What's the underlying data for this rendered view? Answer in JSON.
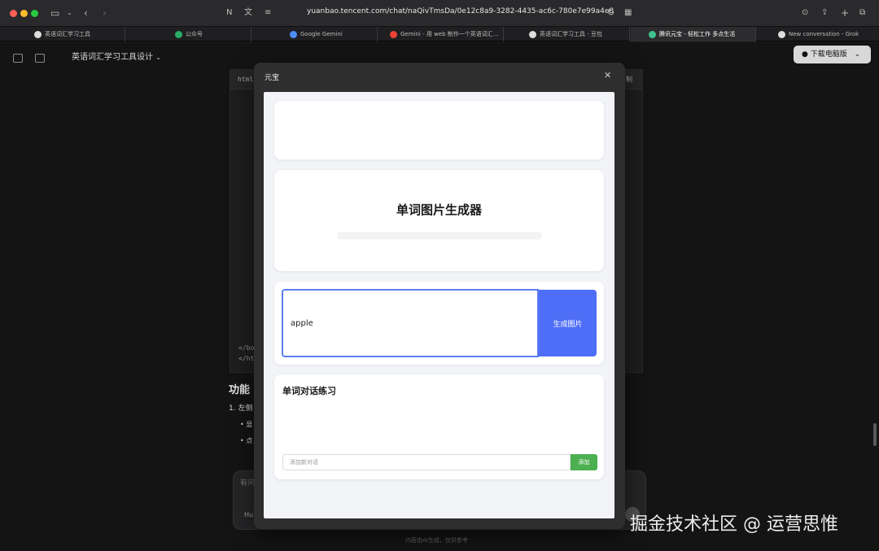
{
  "browser": {
    "url": "yuanbao.tencent.com/chat/naQivTmsDa/0e12c8a9-3282-4435-ac6c-780e7e99a4e8",
    "tabs": [
      {
        "label": "英语词汇学习工具",
        "icon_color": "#dddddd"
      },
      {
        "label": "公众号",
        "icon_color": "#2aae67"
      },
      {
        "label": "Google Gemini",
        "icon_color": "#4e8cf7"
      },
      {
        "label": "Gemini - 用 web 制作一个英语词汇…",
        "icon_color": "#ea4335"
      },
      {
        "label": "英语词汇学习工具 - 豆包",
        "icon_color": "#dddddd"
      },
      {
        "label": "腾讯元宝 - 轻松工作 多点生活",
        "icon_color": "#3ec28f",
        "active": true
      },
      {
        "label": "New conversation - Grok",
        "icon_color": "#dddddd"
      }
    ]
  },
  "page": {
    "chat_title": "英语词汇学习工具设计",
    "chat_title_chevron": "chevron-down-icon",
    "download_button": "下载电脑版",
    "code_lang": "html",
    "code_copy": "制",
    "code_lines": [
      "</bo",
      "</ht"
    ],
    "heading": "功能",
    "list_item": "1.  左侧",
    "bullets": [
      "•  显",
      "•  点"
    ],
    "input_hint": "有问",
    "model_label": "Hu",
    "footer_note": "内容由AI生成，仅供参考",
    "watermark": "掘金技术社区 @ 运营思惟"
  },
  "modal": {
    "title": "元宝",
    "close_icon": "close-icon",
    "app": {
      "title": "单词图片生成器",
      "word_input_value": "apple",
      "generate_button": "生成图片",
      "dialog_title": "单词对话练习",
      "dialog_placeholder": "添加新对话",
      "add_button": "添加"
    }
  },
  "colors": {
    "accent_blue": "#4f6ef7",
    "add_green": "#4caf50",
    "preview_bg": "#f3f4f8",
    "modal_bg": "#2e2e2f"
  }
}
